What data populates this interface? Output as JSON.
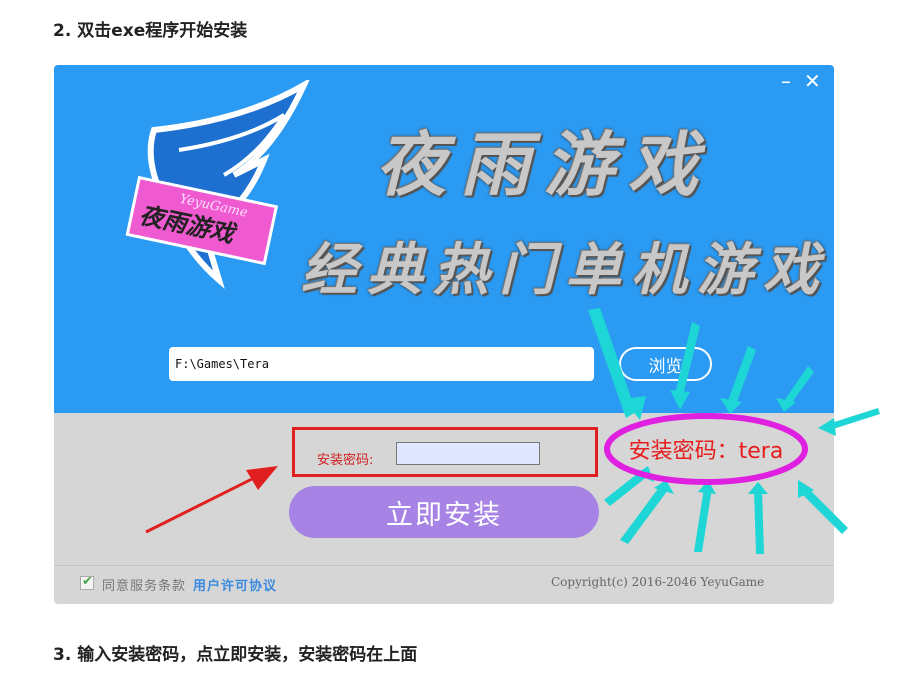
{
  "article": {
    "step2_heading": "2. 双击exe程序开始安装",
    "step3_heading": "3. 输入安装密码，点立即安装，安装密码在上面"
  },
  "installer": {
    "window_controls": {
      "minimize": "–",
      "close": "✕"
    },
    "title_main": "夜雨游戏",
    "title_sub": "经典热门单机游戏",
    "logo": {
      "banner_text": "YeyuGame",
      "tag_text": "夜雨游戏"
    },
    "install_path": "F:\\Games\\Tera",
    "browse_label": "浏览",
    "password_label": "安装密码:",
    "password_value": "",
    "install_button": "立即安装",
    "agree_label": "同意服务条款",
    "license_link": "用户许可协议",
    "copyright": "Copyright(c) 2016-2046 YeyuGame"
  },
  "annotation": {
    "password_hint": "安装密码：tera"
  },
  "colors": {
    "top_panel": "#2a9af3",
    "install_button": "#a683e4",
    "highlight_red": "#e02020",
    "annotation_magenta": "#e020e0",
    "arrow_cyan": "#1ed6d6"
  }
}
